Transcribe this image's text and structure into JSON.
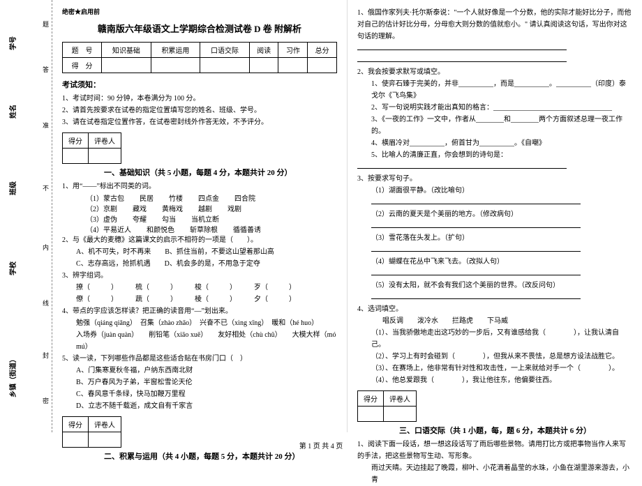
{
  "margin": {
    "labels": [
      "学号",
      "姓名",
      "班级",
      "学校",
      "乡镇（街道）"
    ],
    "dash_hints": [
      "题",
      "答",
      "准",
      "不",
      "内",
      "线",
      "封",
      "密"
    ]
  },
  "secret": "绝密★启用前",
  "title": "赣南版六年级语文上学期综合检测试卷 D 卷 附解析",
  "score_table": {
    "row1": [
      "题　号",
      "知识基础",
      "积累运用",
      "口语交际",
      "阅读",
      "习作",
      "总分"
    ],
    "row2": [
      "得　分",
      "",
      "",
      "",
      "",
      "",
      ""
    ]
  },
  "notice_head": "考试须知：",
  "notice": [
    "1、考试时间：90 分钟，本卷满分为 100 分。",
    "2、请首先按要求在试卷的指定位置填写您的姓名、班级、学号。",
    "3、请在试卷指定位置作答，在试卷密封线外作答无效，不予评分。"
  ],
  "mini_table": {
    "c1": "得分",
    "c2": "评卷人"
  },
  "s1": {
    "title": "一、基础知识（共 5 小题，每题 4 分，本题共计 20 分）",
    "q1": "1、用“——”标出不同类的词。",
    "q1_rows": [
      [
        "（1）蒙古包",
        "民居",
        "竹楼",
        "四点金",
        "四合院"
      ],
      [
        "（2）京剧",
        "藏戏",
        "黄梅戏",
        "越剧",
        "戏剧"
      ],
      [
        "（3）虚伪",
        "夸耀",
        "勾当",
        "当机立断",
        ""
      ],
      [
        "（4）平易近人",
        "和颜悦色",
        "斩草除根",
        "循循善诱",
        ""
      ]
    ],
    "q2": "2、与《最大的麦穗》这篇课文的启示不相符的一项是（　　）。",
    "q2_opts": [
      "A、机不可失，时不再来　　B、抓住当前，不要这山望着那山高",
      "C、志存高远，抢抓机遇　　D、机会多的是，不用急于定夺"
    ],
    "q3": "3、辨字组词。",
    "q3_rows": [
      "撩（　　　）　　　梳（　　　）　　　梭（　　　）　　　歹（　　　）",
      "僚（　　　）　　　蔬（　　　）　　　棱（　　　）　　　夕（　　　）"
    ],
    "q4": "4、带点的字应该怎样读？把正确的读音用“—”划出来。",
    "q4_lines": [
      "勉强（qiáng qiǎng）　召集（zhào zhāo）　兴奋不已（xìng xīng）　暖和（hé huo）",
      "入场券（juàn quàn）　　削铅笔（xiāo xuē）　　友好相处（chù chǔ）　　大模大样（mó mú）"
    ],
    "q5": "5、读一读，下列哪些作品都是这些适合贴在书房门口（　）",
    "q5_opts": [
      "A、门集寒夏秋冬福，户纳东西南北财",
      "B、万户春风为子弟，半窗松雪论天伦",
      "C、春风意千条绿，快马加鞭万里程",
      "D、立志不随千载逝，成文自有千家言"
    ]
  },
  "s2": {
    "title": "二、积累与运用（共 4 小题，每题 5 分，本题共计 20 分）",
    "q1_intro": "1、俄国作家列夫·托尔斯泰说：\"一个人就好像是一个分数，他的实际才能好比分子，而他对自己的估计好比分母，分母愈大则分数的值就愈小。\" 请认真阅读这句话，写出你对这句话的理解。",
    "q2": "2、我会按要求默写或填空。",
    "q2_items": [
      {
        "n": "1、",
        "text": "使弈石臻于完美的，并非__________，而是__________。__________（印度）泰戈尔《飞鸟集》"
      },
      {
        "n": "2、",
        "text": "写一句说明实践才能出真知的格言：__________________________________"
      },
      {
        "n": "3、",
        "text": "《一夜的工作》一文中，作者从________和________两个方面叙述总理一夜工作的。"
      },
      {
        "n": "4、",
        "text": "横眉冷对__________，俯首甘为__________。《自嘲》"
      },
      {
        "n": "5、",
        "text": "比喻人的清廉正直，你会想到的诗句是："
      }
    ],
    "q3": "3、按要求写句子。",
    "q3_items": [
      "（1）湖面很平静。（改比喻句）",
      "（2）云南的夏天是个美丽的地方。（修改病句）",
      "（3）雪花落在头发上。（扩句）",
      "（4）蝴蝶在花丛中飞来飞去。（改拟人句）",
      "（5）没有太阳，就不会有我们这个美丽的世界。（改反问句）"
    ],
    "q4": "4、选词填空。",
    "q4_row": "唱反调　　泼冷水　　拦路虎　　下马威",
    "q4_items": [
      "（1）、当我骄傲地走出这巧妙的一步后，又有谁感给我（　　　　），让我认清自己。",
      "（2）、学习上有时会碰到（　　　　），但我从来不畏怯，总是想方设法战胜它。",
      "（3）、在赛场上，他非常有针对性和攻击性，一上来就给对手一个（　　　　）。",
      "（4）、他总爱跟我（　　　　），我让他往东，他偏要往西。"
    ]
  },
  "s3": {
    "title": "三、口语交际（共 1 小题，每，题 6 分，本题共计 6 分）",
    "q1": "1、阅读下面一段话，想一想这段话写了雨后哪些景物。请用打比方或把事物当作人来写的手法，把这些景物写生动、写形象。",
    "q1_para": "雨过天晴。天边挂起了晚霞，柳叶、小花滴着晶莹的水珠，小鱼在湖里游来游去，小青"
  },
  "footer": "第 1 页 共 4 页"
}
